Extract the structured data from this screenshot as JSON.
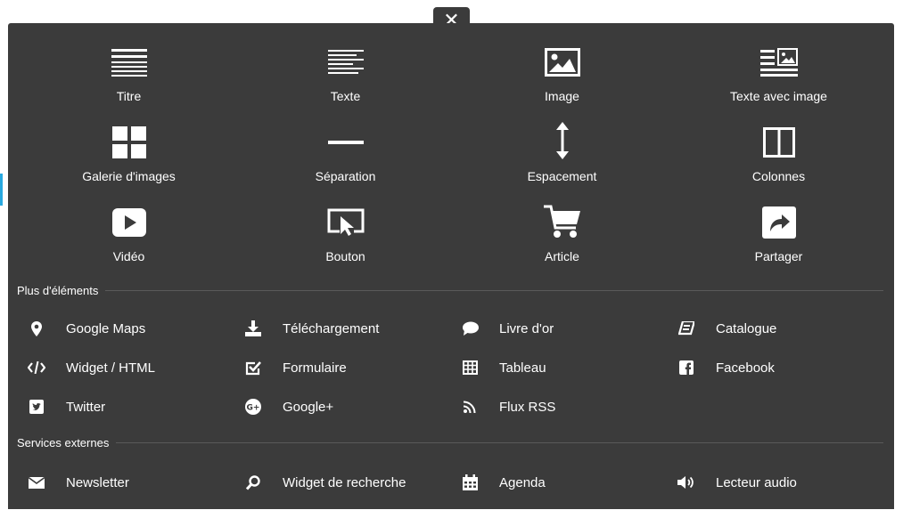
{
  "blocks": [
    {
      "label": "Titre",
      "icon": "title-lines-icon"
    },
    {
      "label": "Texte",
      "icon": "text-lines-icon"
    },
    {
      "label": "Image",
      "icon": "image-icon"
    },
    {
      "label": "Texte avec image",
      "icon": "text-with-image-icon"
    },
    {
      "label": "Galerie d'images",
      "icon": "gallery-grid-icon"
    },
    {
      "label": "Séparation",
      "icon": "separator-line-icon"
    },
    {
      "label": "Espacement",
      "icon": "vertical-arrows-icon"
    },
    {
      "label": "Colonnes",
      "icon": "columns-icon"
    },
    {
      "label": "Vidéo",
      "icon": "video-play-icon"
    },
    {
      "label": "Bouton",
      "icon": "button-cursor-icon"
    },
    {
      "label": "Article",
      "icon": "shopping-cart-icon"
    },
    {
      "label": "Partager",
      "icon": "share-arrow-icon"
    }
  ],
  "more_elements": {
    "title": "Plus d'éléments",
    "items": [
      {
        "label": "Google Maps",
        "icon": "map-pin-icon"
      },
      {
        "label": "Téléchargement",
        "icon": "download-icon"
      },
      {
        "label": "Livre d'or",
        "icon": "speech-bubble-icon"
      },
      {
        "label": "Catalogue",
        "icon": "catalog-book-icon"
      },
      {
        "label": "Widget / HTML",
        "icon": "code-icon"
      },
      {
        "label": "Formulaire",
        "icon": "checkbox-form-icon"
      },
      {
        "label": "Tableau",
        "icon": "table-grid-icon"
      },
      {
        "label": "Facebook",
        "icon": "facebook-icon"
      },
      {
        "label": "Twitter",
        "icon": "twitter-icon"
      },
      {
        "label": "Google+",
        "icon": "google-plus-icon"
      },
      {
        "label": "Flux RSS",
        "icon": "rss-icon"
      }
    ]
  },
  "external_services": {
    "title": "Services externes",
    "items": [
      {
        "label": "Newsletter",
        "icon": "envelope-icon"
      },
      {
        "label": "Widget de recherche",
        "icon": "search-icon"
      },
      {
        "label": "Agenda",
        "icon": "calendar-icon"
      },
      {
        "label": "Lecteur audio",
        "icon": "speaker-icon"
      }
    ]
  },
  "close": {
    "glyph": "✕"
  },
  "colors": {
    "panel": "#3b3b3b",
    "text": "#ffffff",
    "accent": "#29a9e0"
  }
}
